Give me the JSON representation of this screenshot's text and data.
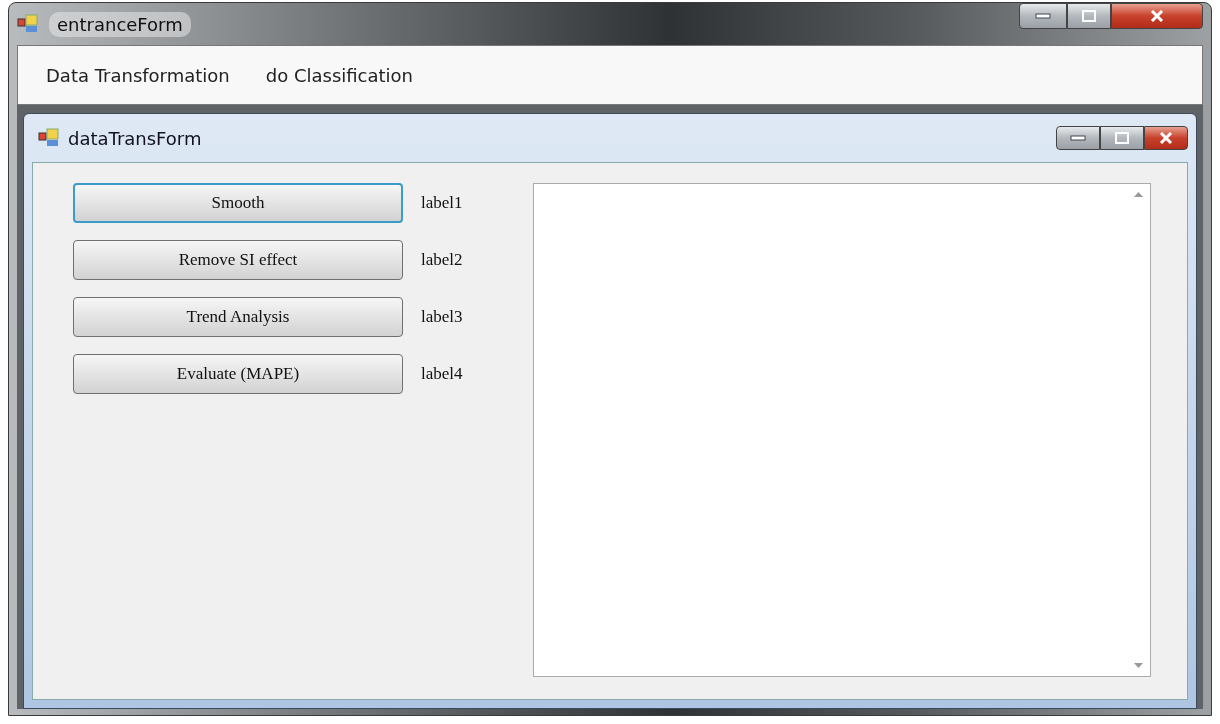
{
  "window": {
    "title": "entranceForm"
  },
  "menu": [
    {
      "label": "Data Transformation"
    },
    {
      "label": "do Classification"
    }
  ],
  "child_window": {
    "title": "dataTransForm",
    "actions": [
      {
        "label": "Smooth",
        "focused": true,
        "result": "label1"
      },
      {
        "label": "Remove SI effect",
        "focused": false,
        "result": "label2"
      },
      {
        "label": "Trend Analysis",
        "focused": false,
        "result": "label3"
      },
      {
        "label": "Evaluate (MAPE)",
        "focused": false,
        "result": "label4"
      }
    ]
  }
}
